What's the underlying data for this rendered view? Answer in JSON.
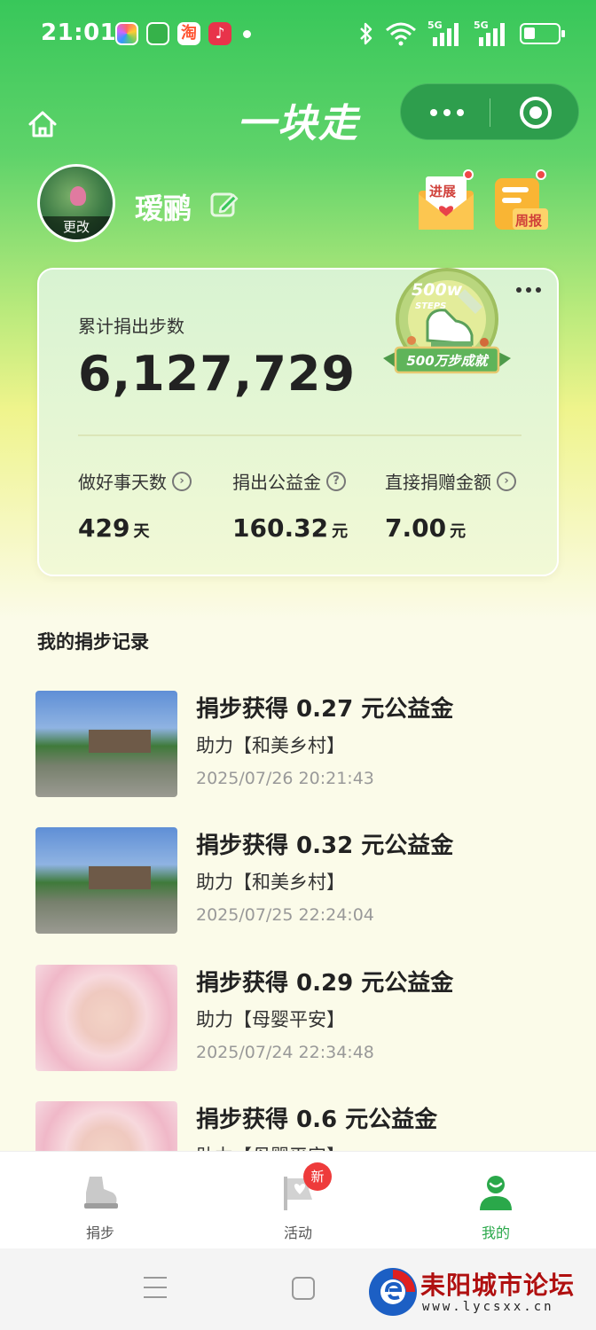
{
  "status_bar": {
    "time": "21:01",
    "network_1": "5G",
    "network_2": "5G",
    "app_icons": [
      "gallery-icon",
      "phone-manager-icon",
      "taobao-icon",
      "music-icon"
    ],
    "icons": [
      "bluetooth-icon",
      "wifi-icon",
      "signal-icon",
      "battery-icon"
    ]
  },
  "header": {
    "title": "一块走"
  },
  "profile": {
    "username": "瑷鹂",
    "avatar_change_label": "更改",
    "progress_label": "进展",
    "weekly_label": "周报"
  },
  "summary_card": {
    "total_label": "累计捐出步数",
    "total_value": "6,127,729",
    "achievement": {
      "badge_top": "500w",
      "badge_steps": "STEPS",
      "badge_text": "500万步成就"
    },
    "stats": [
      {
        "label": "做好事天数",
        "value": "429",
        "unit": "天"
      },
      {
        "label": "捐出公益金",
        "value": "160.32",
        "unit": "元"
      },
      {
        "label": "直接捐赠金额",
        "value": "7.00",
        "unit": "元"
      }
    ]
  },
  "records": {
    "section_title": "我的捐步记录",
    "items": [
      {
        "title": "捐步获得 0.27 元公益金",
        "project": "助力【和美乡村】",
        "time": "2025/07/26 20:21:43",
        "image": "village"
      },
      {
        "title": "捐步获得 0.32 元公益金",
        "project": "助力【和美乡村】",
        "time": "2025/07/25 22:24:04",
        "image": "village"
      },
      {
        "title": "捐步获得 0.29 元公益金",
        "project": "助力【母婴平安】",
        "time": "2025/07/24 22:34:48",
        "image": "baby"
      },
      {
        "title": "捐步获得 0.6 元公益金",
        "project": "助力【母婴平安】",
        "time": "",
        "image": "baby"
      }
    ]
  },
  "tab_bar": {
    "tabs": [
      {
        "label": "捐步",
        "icon": "shoe-icon",
        "active": false
      },
      {
        "label": "活动",
        "icon": "flag-icon",
        "active": false,
        "badge": "新"
      },
      {
        "label": "我的",
        "icon": "user-icon",
        "active": true
      }
    ]
  },
  "watermark": {
    "title": "耒阳城市论坛",
    "url": "www.lycsxx.cn"
  },
  "colors": {
    "brand_green": "#2aa84a",
    "badge_red": "#ee3b3b",
    "card_bg": "#eef7d4"
  }
}
